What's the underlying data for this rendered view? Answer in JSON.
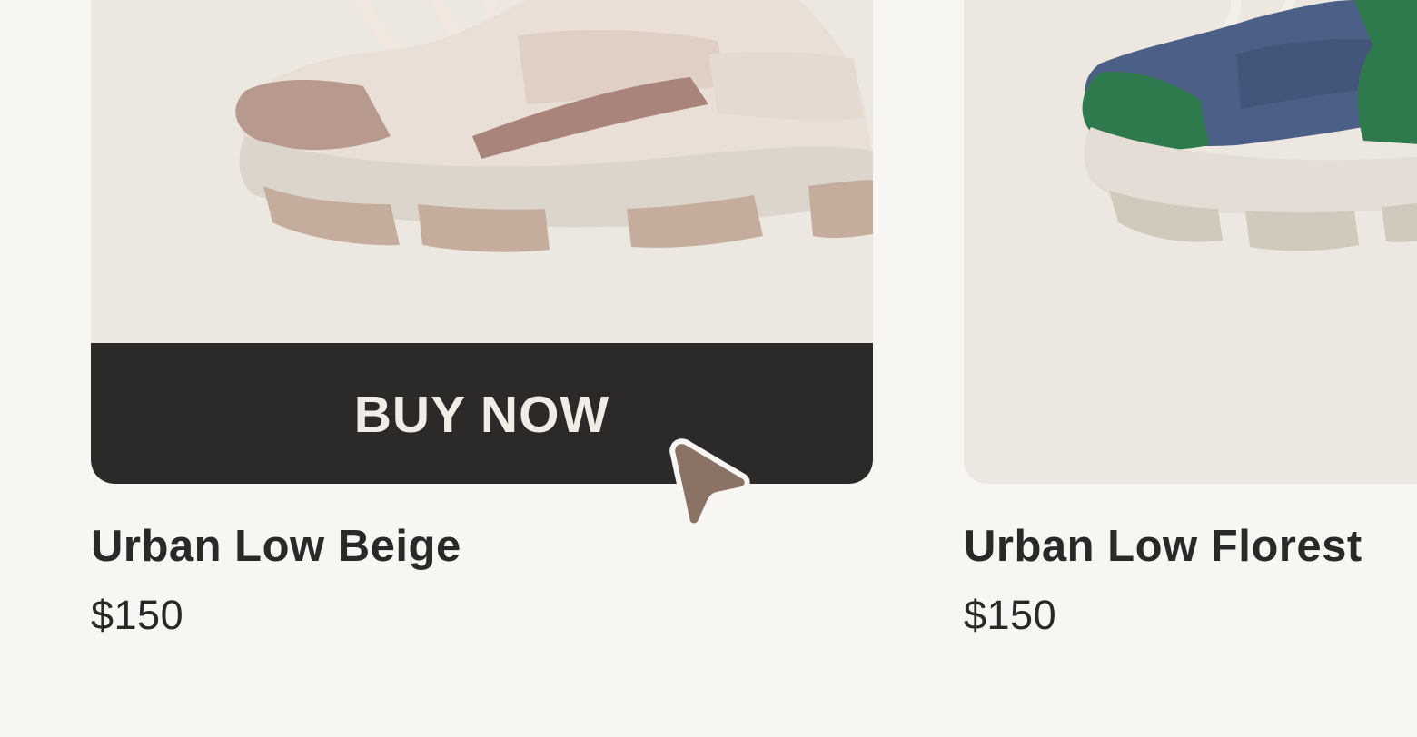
{
  "products": [
    {
      "name": "Urban Low Beige",
      "price": "$150",
      "button_label": "BUY NOW",
      "colors": {
        "upper": "#e7d9cf",
        "accent": "#a8847a",
        "sole": "#dcd5cc",
        "tread": "#c4ad9c"
      }
    },
    {
      "name": "Urban Low Florest",
      "price": "$150",
      "colors": {
        "upper": "#4c5f86",
        "accent": "#2f7a4c",
        "sole": "#e3ddd5",
        "tread": "#d2c9bd"
      }
    }
  ],
  "theme": {
    "background": "#f8f6f3",
    "card_background": "#ece7e1",
    "button_background": "#2b2a29",
    "button_text": "#f1ece6",
    "cursor_color": "#8a7264"
  },
  "icons": {
    "cursor": "pointer-cursor-icon",
    "shoe_1": "sneaker-beige-icon",
    "shoe_2": "sneaker-green-blue-icon"
  }
}
